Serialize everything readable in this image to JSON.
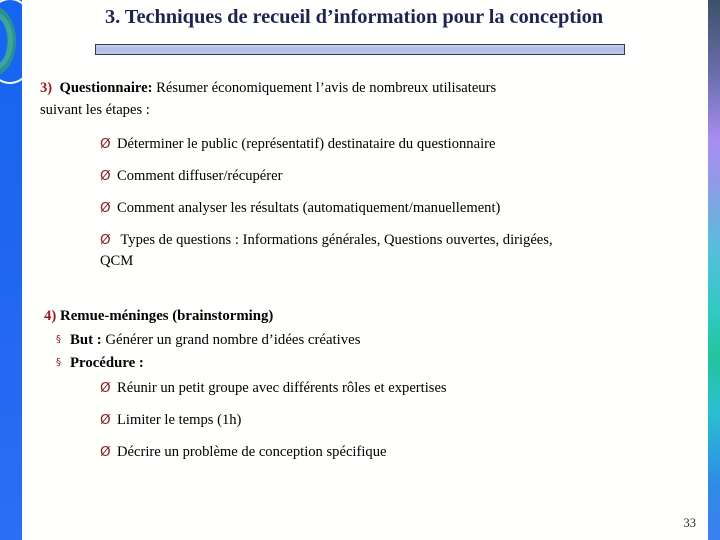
{
  "slide": {
    "title": "3. Techniques de recueil d’information pour la conception",
    "page_number": "33",
    "accent_red": "#8c1d21",
    "title_color": "#1f2452",
    "bar_fill": "#b3bbe4",
    "bar_border": "#33365e",
    "left_bar_color": "#1f66ef"
  },
  "sections": {
    "questionnaire": {
      "marker": "3)",
      "label": "Questionnaire:",
      "text": " Résumer économiquement l’avis de nombreux utilisateurs",
      "second_line": "suivant les étapes :",
      "bullets": [
        {
          "glyph": "Ø",
          "text": "Déterminer le public (représentatif) destinataire du questionnaire"
        },
        {
          "glyph": "Ø",
          "text": "Comment diffuser/récupérer"
        },
        {
          "glyph": "Ø",
          "text": "Comment analyser les résultats (automatiquement/manuellement)"
        },
        {
          "glyph": "Ø",
          "text": " Types de questions : Informations générales, Questions ouvertes, dirigées,",
          "continuation": "QCM"
        }
      ]
    },
    "brainstorming": {
      "marker": "4)",
      "label": "Remue-méninges (brainstorming)",
      "sub_bullets": [
        {
          "glyph": "§",
          "label": "But :",
          "text": " Générer un grand nombre d’idées créatives"
        },
        {
          "glyph": "§",
          "label": "Procédure :",
          "text": ""
        }
      ],
      "bullets": [
        {
          "glyph": "Ø",
          "text": "Réunir un petit groupe avec différents rôles et expertises"
        },
        {
          "glyph": "Ø",
          "text": "Limiter le temps (1h)"
        },
        {
          "glyph": "Ø",
          "text": "Décrire un problème de conception spécifique"
        }
      ]
    }
  }
}
